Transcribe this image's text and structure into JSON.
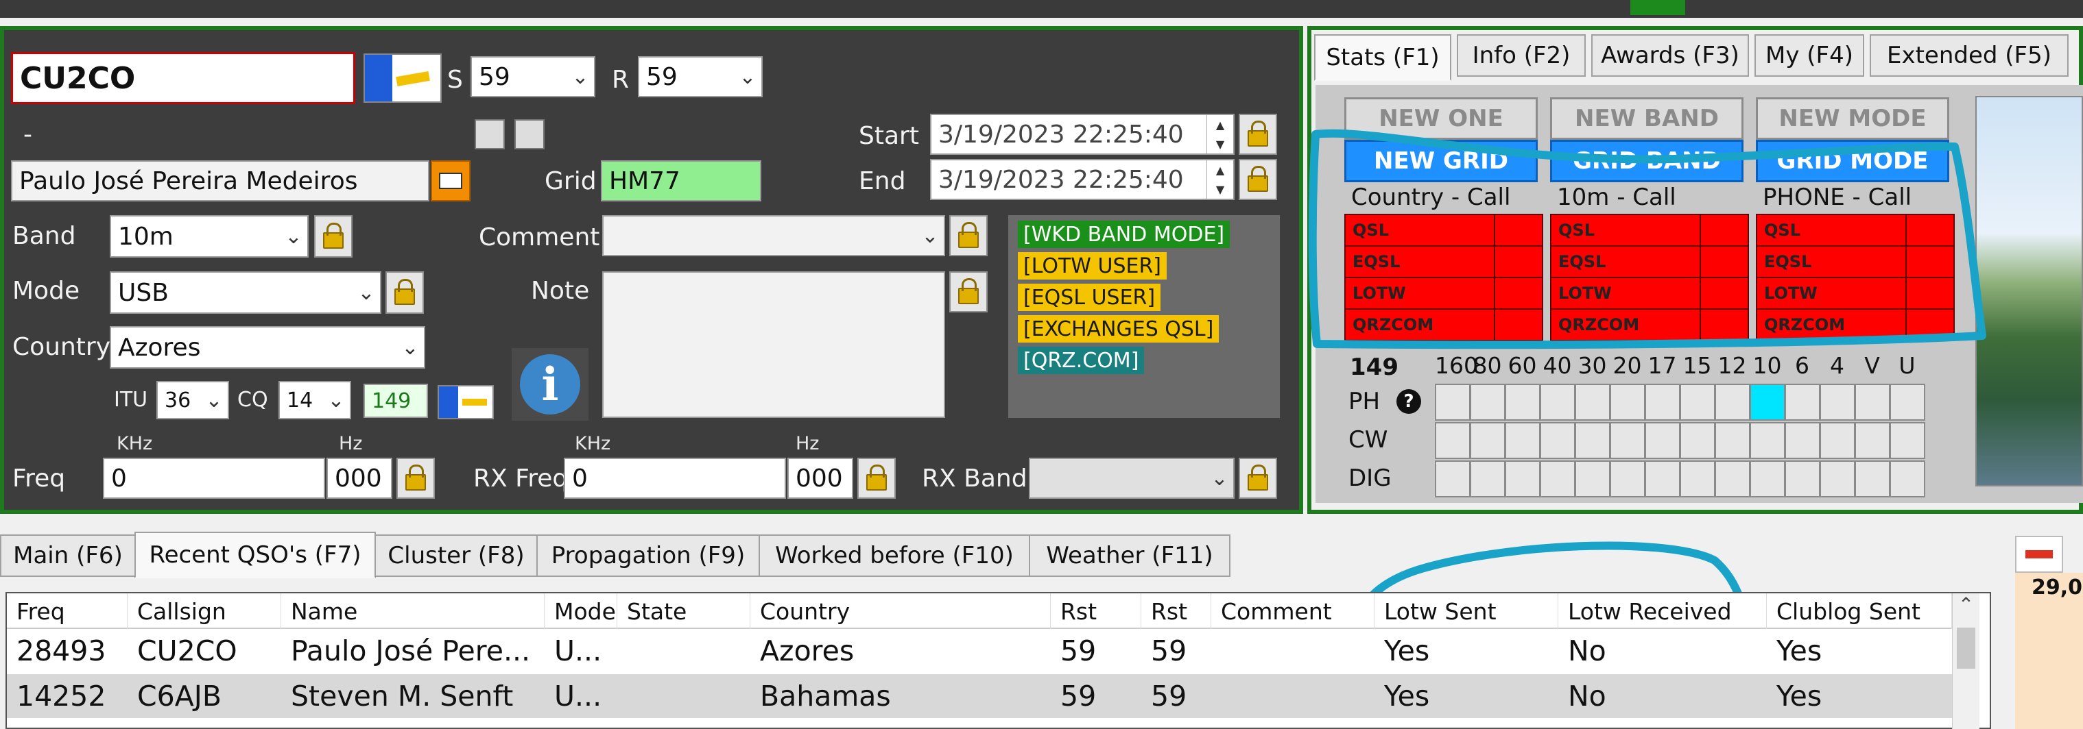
{
  "entry": {
    "callsign": "CU2CO",
    "rst_s_label": "S",
    "rst_s_value": "59",
    "rst_r_label": "R",
    "rst_r_value": "59",
    "dash": "-",
    "name": "Paulo José Pereira Medeiros",
    "grid_label": "Grid",
    "grid_value": "HM77",
    "start_label": "Start",
    "start_value": "3/19/2023 22:25:40",
    "end_label": "End",
    "end_value": "3/19/2023 22:25:40",
    "band_label": "Band",
    "band_value": "10m",
    "mode_label": "Mode",
    "mode_value": "USB",
    "country_label": "Country",
    "country_value": "Azores",
    "comment_label": "Comment",
    "comment_value": "",
    "note_label": "Note",
    "itu_label": "ITU",
    "itu_value": "36",
    "cq_label": "CQ",
    "cq_value": "14",
    "dxcc_number": "149",
    "khz_label": "KHz",
    "hz_label": "Hz",
    "freq_label": "Freq",
    "freq_khz": "0",
    "freq_hz": "000",
    "rxfreq_label": "RX Freq",
    "rxfreq_khz": "0",
    "rxfreq_hz": "000",
    "rxband_label": "RX Band",
    "info_icon": "info-icon",
    "tags": [
      {
        "text": "[WKD BAND MODE]",
        "bg": "#1a8f1a",
        "fg": "#ffffff"
      },
      {
        "text": "[LOTW USER]",
        "bg": "#f5c400",
        "fg": "#1a1a1a"
      },
      {
        "text": "[EQSL USER]",
        "bg": "#f5c400",
        "fg": "#1a1a1a"
      },
      {
        "text": "[EXCHANGES QSL]",
        "bg": "#f5c400",
        "fg": "#1a1a1a"
      },
      {
        "text": "[QRZ.COM]",
        "bg": "#1a7f7f",
        "fg": "#ffffff"
      }
    ]
  },
  "stats": {
    "tabs": [
      "Stats (F1)",
      "Info (F2)",
      "Awards (F3)",
      "My (F4)",
      "Extended (F5)"
    ],
    "new_headers": [
      "NEW ONE",
      "NEW BAND",
      "NEW MODE"
    ],
    "grid_headers": [
      "NEW GRID",
      "GRID BAND",
      "GRID MODE"
    ],
    "call_headers": [
      "Country - Call",
      "10m - Call",
      "PHONE - Call"
    ],
    "qsl_rows": [
      "QSL",
      "EQSL",
      "LOTW",
      "QRZCOM"
    ],
    "dxcc": "149",
    "bands": [
      "160",
      "80",
      "60",
      "40",
      "30",
      "20",
      "17",
      "15",
      "12",
      "10",
      "6",
      "4",
      "V",
      "U"
    ],
    "modes": [
      "PH",
      "CW",
      "DIG"
    ],
    "help_icon": "help-icon",
    "highlighted": {
      "mode": "PH",
      "band": "10"
    }
  },
  "bottom_tabs": [
    "Main (F6)",
    "Recent QSO's (F7)",
    "Cluster (F8)",
    "Propagation (F9)",
    "Worked before (F10)",
    "Weather (F11)"
  ],
  "side_number": "29,0",
  "table": {
    "columns": [
      "Freq",
      "Callsign",
      "Name",
      "Mode",
      "State",
      "Country",
      "Rst",
      "Rst",
      "Comment",
      "Lotw Sent",
      "Lotw Received",
      "Clublog Sent"
    ],
    "rows": [
      [
        "28493",
        "CU2CO",
        "Paulo José Pere...",
        "U...",
        "",
        "Azores",
        "59",
        "59",
        "",
        "Yes",
        "No",
        "Yes"
      ],
      [
        "14252",
        "C6AJB",
        "Steven M. Senft",
        "U...",
        "",
        "Bahamas",
        "59",
        "59",
        "",
        "Yes",
        "No",
        "Yes"
      ]
    ]
  },
  "colors": {
    "annotation": "#1aa3c8",
    "panel_border": "#1f7a1f",
    "grid_field": "#90ee90"
  }
}
